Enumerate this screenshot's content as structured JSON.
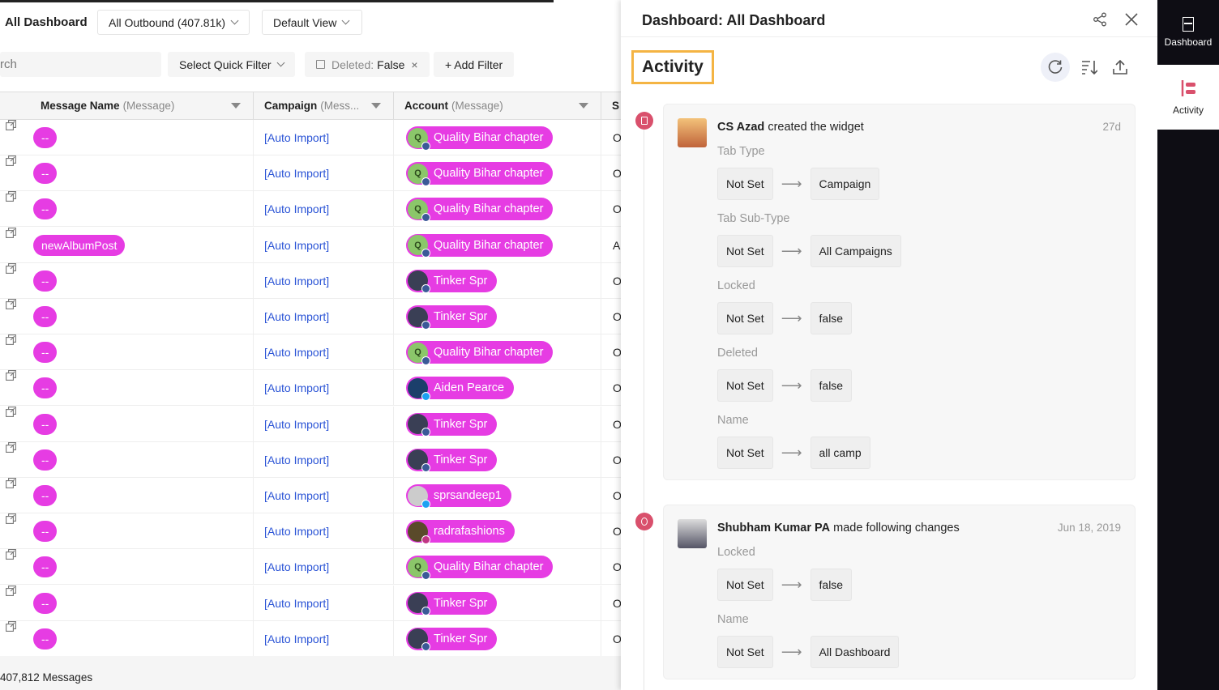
{
  "header": {
    "title": "All Dashboard",
    "view_select": "All Outbound (407.81k)",
    "layout_select": "Default View"
  },
  "filters": {
    "search_value": "rch",
    "quick_filter": "Select Quick Filter",
    "chip_label": "Deleted:",
    "chip_value": "False",
    "add_filter": "+ Add Filter"
  },
  "table": {
    "columns": [
      {
        "label": "Message Name",
        "sub": "(Message)"
      },
      {
        "label": "Campaign",
        "sub": "(Mess..."
      },
      {
        "label": "Account",
        "sub": "(Message)"
      },
      {
        "label": "S",
        "sub": ""
      }
    ],
    "rows": [
      {
        "name": "--",
        "campaign": "[Auto Import]",
        "account": "Quality Bihar chapter",
        "av": "q",
        "net": "fb",
        "s": "O"
      },
      {
        "name": "--",
        "campaign": "[Auto Import]",
        "account": "Quality Bihar chapter",
        "av": "q",
        "net": "fb",
        "s": "O"
      },
      {
        "name": "--",
        "campaign": "[Auto Import]",
        "account": "Quality Bihar chapter",
        "av": "q",
        "net": "fb",
        "s": "O"
      },
      {
        "name": "newAlbumPost",
        "campaign": "[Auto Import]",
        "account": "Quality Bihar chapter",
        "av": "q",
        "net": "fb",
        "s": "A"
      },
      {
        "name": "--",
        "campaign": "[Auto Import]",
        "account": "Tinker Spr",
        "av": "t",
        "net": "fb",
        "s": "O"
      },
      {
        "name": "--",
        "campaign": "[Auto Import]",
        "account": "Tinker Spr",
        "av": "t",
        "net": "fb",
        "s": "O"
      },
      {
        "name": "--",
        "campaign": "[Auto Import]",
        "account": "Quality Bihar chapter",
        "av": "q",
        "net": "fb",
        "s": "O"
      },
      {
        "name": "--",
        "campaign": "[Auto Import]",
        "account": "Aiden Pearce",
        "av": "a",
        "net": "tw",
        "s": "O"
      },
      {
        "name": "--",
        "campaign": "[Auto Import]",
        "account": "Tinker Spr",
        "av": "t",
        "net": "fb",
        "s": "O"
      },
      {
        "name": "--",
        "campaign": "[Auto Import]",
        "account": "Tinker Spr",
        "av": "t",
        "net": "fb",
        "s": "O"
      },
      {
        "name": "--",
        "campaign": "[Auto Import]",
        "account": "sprsandeep1",
        "av": "s",
        "net": "tw",
        "s": "O"
      },
      {
        "name": "--",
        "campaign": "[Auto Import]",
        "account": "radrafashions",
        "av": "r",
        "net": "ig",
        "s": "O"
      },
      {
        "name": "--",
        "campaign": "[Auto Import]",
        "account": "Quality Bihar chapter",
        "av": "q",
        "net": "fb",
        "s": "O"
      },
      {
        "name": "--",
        "campaign": "[Auto Import]",
        "account": "Tinker Spr",
        "av": "t",
        "net": "fb",
        "s": "O"
      },
      {
        "name": "--",
        "campaign": "[Auto Import]",
        "account": "Tinker Spr",
        "av": "t",
        "net": "fb",
        "s": "O"
      }
    ],
    "footer": "407,812 Messages"
  },
  "panel": {
    "title": "Dashboard: All Dashboard",
    "section": "Activity",
    "activities": [
      {
        "user": "CS Azad",
        "action": "created the widget",
        "time": "27d",
        "icon": "dashboard-icon",
        "changes": [
          {
            "field": "Tab Type",
            "from": "Not Set",
            "to": "Campaign"
          },
          {
            "field": "Tab Sub-Type",
            "from": "Not Set",
            "to": "All Campaigns"
          },
          {
            "field": "Locked",
            "from": "Not Set",
            "to": "false"
          },
          {
            "field": "Deleted",
            "from": "Not Set",
            "to": "false"
          },
          {
            "field": "Name",
            "from": "Not Set",
            "to": "all camp"
          }
        ]
      },
      {
        "user": "Shubham Kumar PA",
        "action": "made following changes",
        "time": "Jun 18, 2019",
        "icon": "tag-icon",
        "changes": [
          {
            "field": "Locked",
            "from": "Not Set",
            "to": "false"
          },
          {
            "field": "Name",
            "from": "Not Set",
            "to": "All Dashboard"
          }
        ]
      }
    ]
  },
  "sidebar": {
    "items": [
      {
        "label": "Dashboard"
      },
      {
        "label": "Activity"
      }
    ]
  },
  "colors": {
    "pill": "#e63ce3",
    "link": "#2b54d6",
    "accent": "#d9506c",
    "highlight": "#f4b443",
    "sidebar": "#0e0d14"
  }
}
